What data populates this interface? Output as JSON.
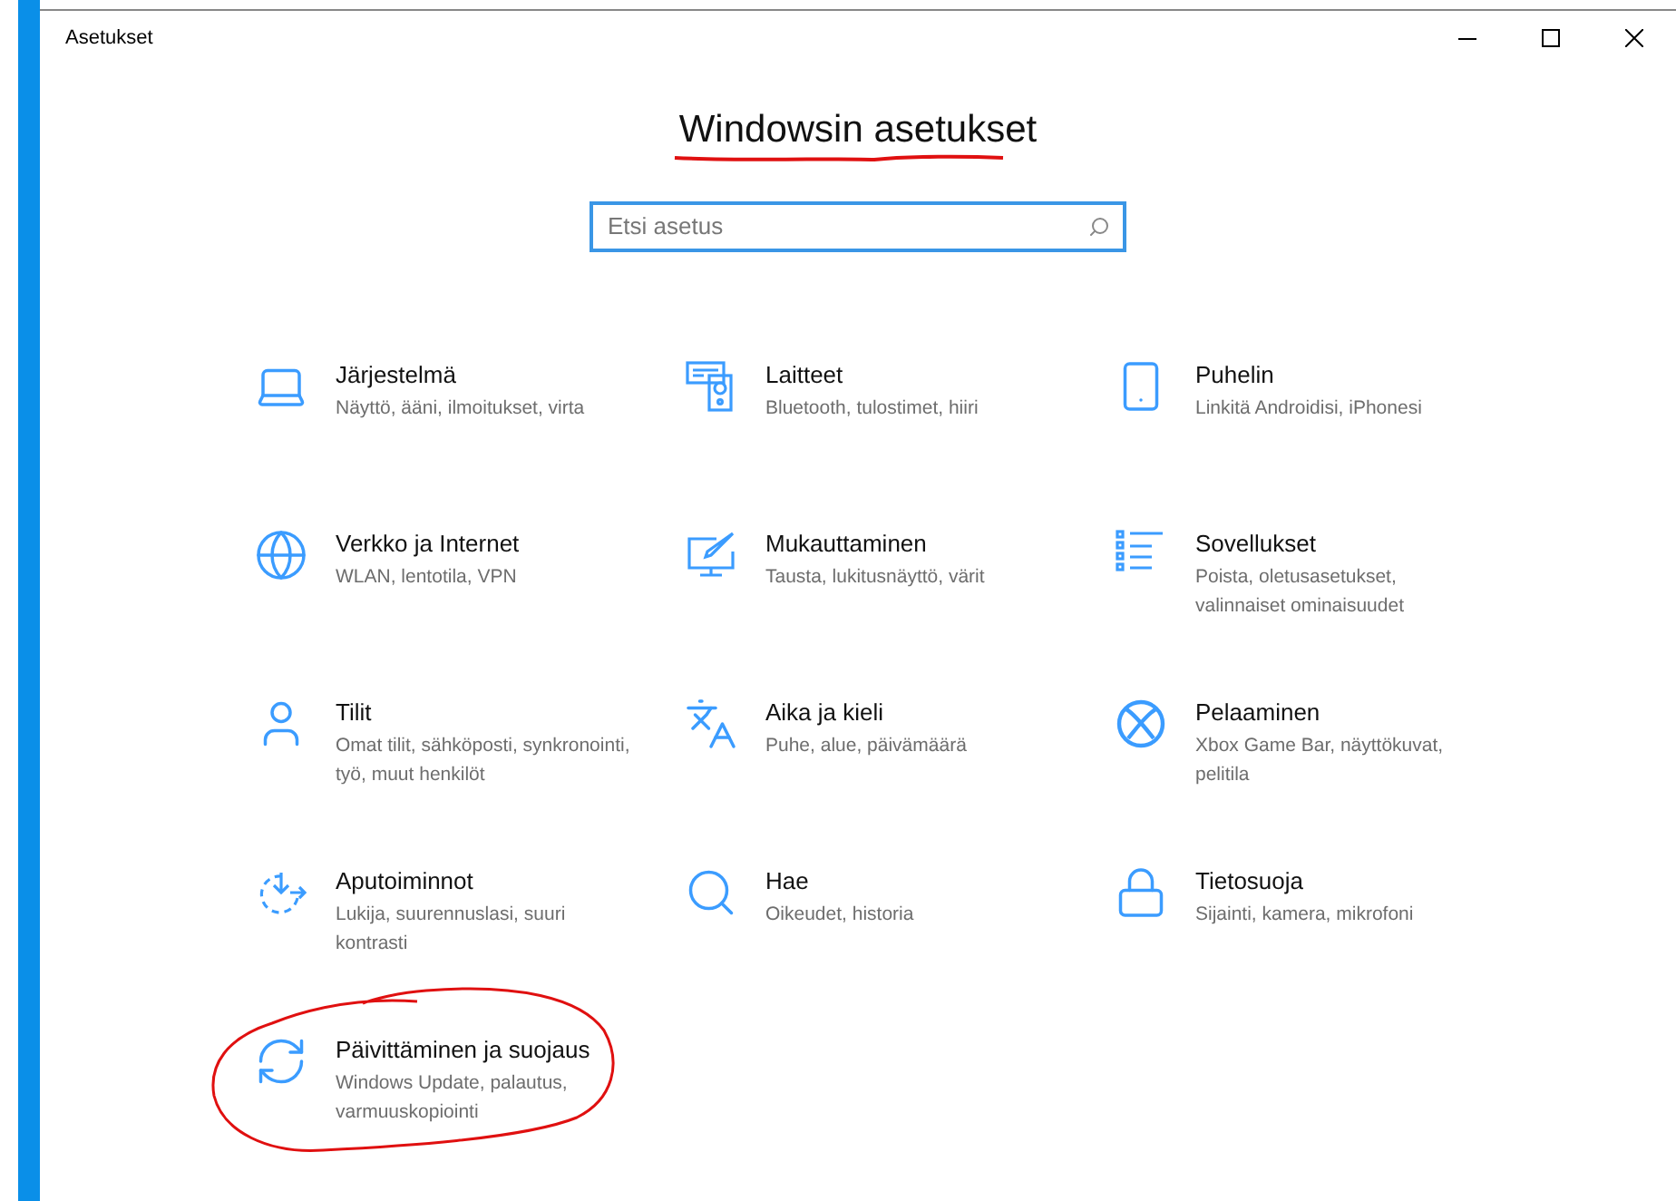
{
  "window": {
    "title": "Asetukset"
  },
  "heading": {
    "text": "Windowsin asetukset",
    "underlined": true
  },
  "search": {
    "placeholder": "Etsi asetus"
  },
  "categories": [
    {
      "title": "Järjestelmä",
      "subtitle": "Näyttö, ääni, ilmoitukset, virta",
      "circled": false
    },
    {
      "title": "Laitteet",
      "subtitle": "Bluetooth, tulostimet, hiiri",
      "circled": false
    },
    {
      "title": "Puhelin",
      "subtitle": "Linkitä Androidisi, iPhonesi",
      "circled": false
    },
    {
      "title": "Verkko ja Internet",
      "subtitle": "WLAN, lentotila, VPN",
      "circled": false
    },
    {
      "title": "Mukauttaminen",
      "subtitle": "Tausta, lukitusnäyttö, värit",
      "circled": false
    },
    {
      "title": "Sovellukset",
      "subtitle": "Poista, oletusasetukset, valinnaiset ominaisuudet",
      "circled": false
    },
    {
      "title": "Tilit",
      "subtitle": "Omat tilit, sähköposti, synkronointi, työ, muut henkilöt",
      "circled": false
    },
    {
      "title": "Aika ja kieli",
      "subtitle": "Puhe, alue, päivämäärä",
      "circled": false
    },
    {
      "title": "Pelaaminen",
      "subtitle": "Xbox Game Bar, näyttökuvat, pelitila",
      "circled": false
    },
    {
      "title": "Aputoiminnot",
      "subtitle": "Lukija, suurennuslasi, suuri kontrasti",
      "circled": false
    },
    {
      "title": "Hae",
      "subtitle": "Oikeudet, historia",
      "circled": false
    },
    {
      "title": "Tietosuoja",
      "subtitle": "Sijainti, kamera, mikrofoni",
      "circled": false
    },
    {
      "title": "Päivittäminen ja suojaus",
      "subtitle": "Windows Update, palautus, varmuuskopiointi",
      "circled": true
    }
  ]
}
